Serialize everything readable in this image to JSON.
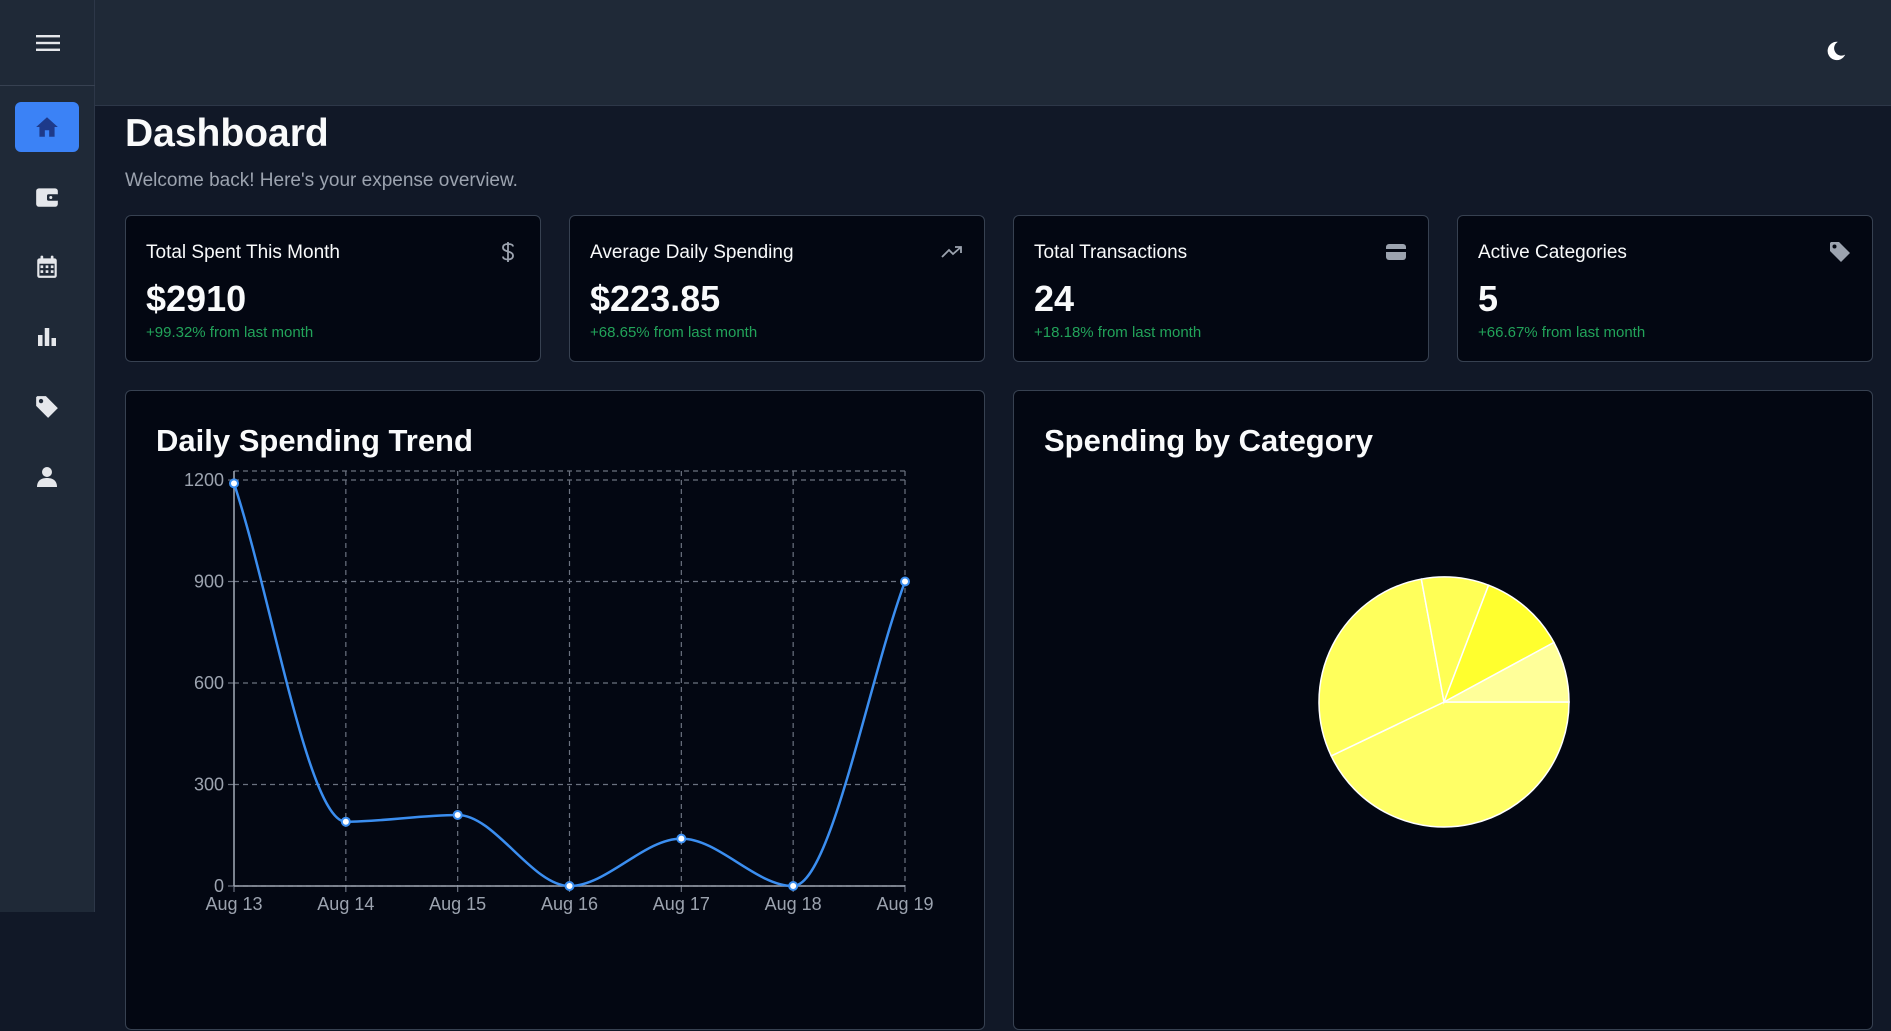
{
  "sidebar": {
    "menu_icon": "hamburger-menu-icon",
    "items": [
      {
        "icon": "home-icon",
        "active": true
      },
      {
        "icon": "wallet-icon",
        "active": false
      },
      {
        "icon": "calendar-icon",
        "active": false
      },
      {
        "icon": "bar-chart-icon",
        "active": false
      },
      {
        "icon": "tag-icon",
        "active": false
      },
      {
        "icon": "user-icon",
        "active": false
      }
    ]
  },
  "header": {
    "theme_icon": "moon-icon"
  },
  "page": {
    "title": "Dashboard",
    "subtitle": "Welcome back! Here's your expense overview."
  },
  "stats": [
    {
      "title": "Total Spent This Month",
      "value": "$2910",
      "change": "+99.32% from last month",
      "icon": "dollar-icon"
    },
    {
      "title": "Average Daily Spending",
      "value": "$223.85",
      "change": "+68.65% from last month",
      "icon": "trending-up-icon"
    },
    {
      "title": "Total Transactions",
      "value": "24",
      "change": "+18.18% from last month",
      "icon": "credit-card-icon"
    },
    {
      "title": "Active Categories",
      "value": "5",
      "change": "+66.67% from last month",
      "icon": "tag-icon"
    }
  ],
  "colors": {
    "accent": "#3b82f6",
    "line": "#3b8ef0",
    "positive": "#22a35a",
    "pie": [
      "#ffff66",
      "#ffff5c",
      "#ffff55",
      "#ffff2e",
      "#ffff99"
    ]
  },
  "chart_data": [
    {
      "type": "line",
      "title": "Daily Spending Trend",
      "categories": [
        "Aug 13",
        "Aug 14",
        "Aug 15",
        "Aug 16",
        "Aug 17",
        "Aug 18",
        "Aug 19"
      ],
      "values": [
        1190,
        190,
        210,
        0,
        140,
        0,
        900
      ],
      "ylim": [
        0,
        1200
      ],
      "yticks": [
        0,
        300,
        600,
        900,
        1200
      ],
      "grid": true,
      "line_style": "smooth"
    },
    {
      "type": "pie",
      "title": "Spending by Category",
      "values": [
        42.9,
        29.2,
        8.7,
        11.3,
        7.9
      ]
    }
  ]
}
